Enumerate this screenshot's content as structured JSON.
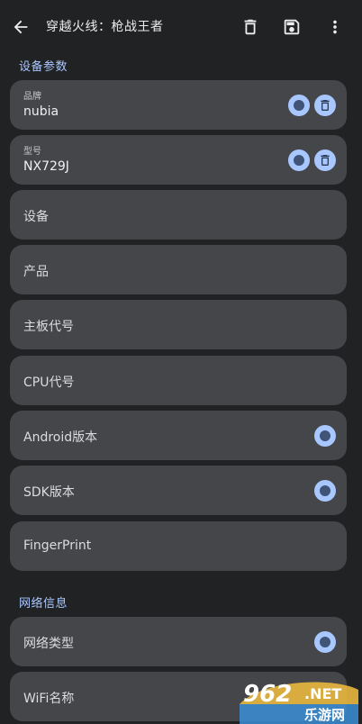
{
  "appbar": {
    "title": "穿越火线：枪战王者",
    "icons": [
      "arrow-back-icon",
      "trash-icon",
      "save-icon",
      "more-vert-icon"
    ]
  },
  "sections": {
    "device": "设备参数",
    "network": "网络信息"
  },
  "fields": {
    "brand": {
      "label": "品牌",
      "value": "nubia"
    },
    "model": {
      "label": "型号",
      "value": "NX729J"
    },
    "device": {
      "label": "设备"
    },
    "product": {
      "label": "产品"
    },
    "board": {
      "label": "主板代号"
    },
    "cpu": {
      "label": "CPU代号"
    },
    "android": {
      "label": "Android版本"
    },
    "sdk": {
      "label": "SDK版本"
    },
    "fingerprint": {
      "label": "FingerPrint"
    },
    "network_type": {
      "label": "网络类型"
    },
    "wifi_name": {
      "label": "WiFi名称"
    }
  },
  "watermark": {
    "text_top": "962",
    "text_net": ".NET",
    "text_bottom": "乐游网"
  },
  "colors": {
    "background": "#212224",
    "card": "#45464a",
    "accent": "#a9c7ff",
    "accent_dark": "#3f5476"
  }
}
